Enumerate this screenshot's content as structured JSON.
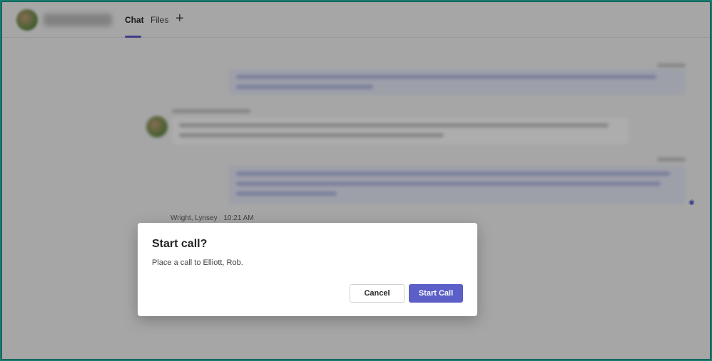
{
  "header": {
    "tabs": [
      {
        "label": "Chat",
        "active": true
      },
      {
        "label": "Files",
        "active": false
      }
    ],
    "add_tab_icon": "plus-icon"
  },
  "conversation": {
    "last_sender": "Wright, Lynsey",
    "last_time": "10:21 AM",
    "read_receipt_icon": "eye-icon"
  },
  "dialog": {
    "title": "Start call?",
    "message": "Place a call to Elliott, Rob.",
    "cancel_label": "Cancel",
    "confirm_label": "Start Call"
  },
  "colors": {
    "accent": "#5b5fc7",
    "frame": "#1a7a70"
  }
}
